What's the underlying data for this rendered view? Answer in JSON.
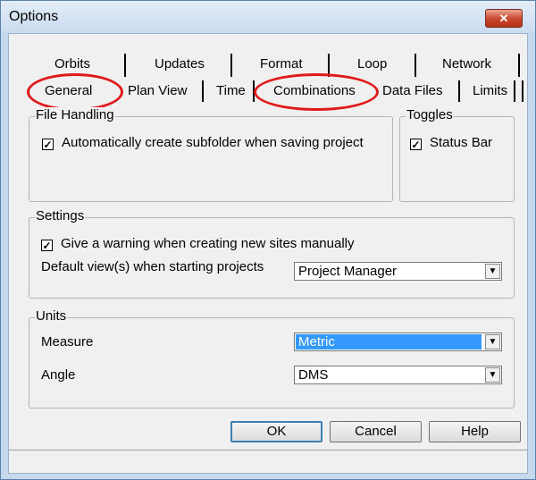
{
  "window": {
    "title": "Options",
    "close_glyph": "✕"
  },
  "tabs": {
    "back": [
      "Orbits",
      "Updates",
      "Format",
      "Loop",
      "Network"
    ],
    "front": [
      "General",
      "Plan View",
      "Time",
      "Combinations",
      "Data Files",
      "Limits"
    ]
  },
  "file_handling": {
    "legend": "File Handling",
    "auto_subfolder_label": "Automatically create subfolder when saving project",
    "auto_subfolder_checked": true
  },
  "toggles": {
    "legend": "Toggles",
    "status_bar_label": "Status Bar",
    "status_bar_checked": true
  },
  "settings": {
    "legend": "Settings",
    "warning_label": "Give a warning when creating new sites manually",
    "warning_checked": true,
    "default_view_label": "Default view(s) when starting projects",
    "default_view_value": "Project Manager"
  },
  "units": {
    "legend": "Units",
    "measure_label": "Measure",
    "measure_value": "Metric",
    "angle_label": "Angle",
    "angle_value": "DMS"
  },
  "buttons": {
    "ok": "OK",
    "cancel": "Cancel",
    "help": "Help"
  },
  "colors": {
    "annotation_circle": "#e0191b",
    "selection": "#3399ff"
  }
}
